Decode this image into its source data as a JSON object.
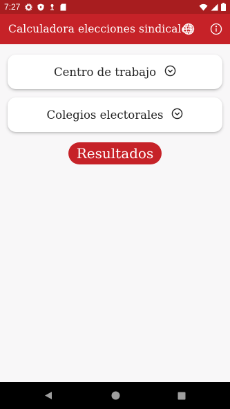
{
  "status_bar": {
    "time": "7:27",
    "icons": [
      "settings-icon",
      "shield-icon",
      "notification-icon",
      "sd-card-icon",
      "wifi-icon",
      "signal-icon",
      "battery-icon"
    ]
  },
  "app_bar": {
    "title": "Calculadora elecciones sindicales",
    "actions": [
      "language-globe-icon",
      "info-icon"
    ]
  },
  "sections": [
    {
      "label": "Centro de trabajo",
      "icon": "chevron-down-circle-icon"
    },
    {
      "label": "Colegios electorales",
      "icon": "chevron-down-circle-icon"
    }
  ],
  "results_button": {
    "label": "Resultados"
  },
  "nav_bar": {
    "items": [
      "back-icon",
      "home-icon",
      "recents-icon"
    ]
  },
  "colors": {
    "status_bar": "#a81d1f",
    "app_bar": "#c62228",
    "accent": "#c62228",
    "background": "#f8f7f8"
  }
}
